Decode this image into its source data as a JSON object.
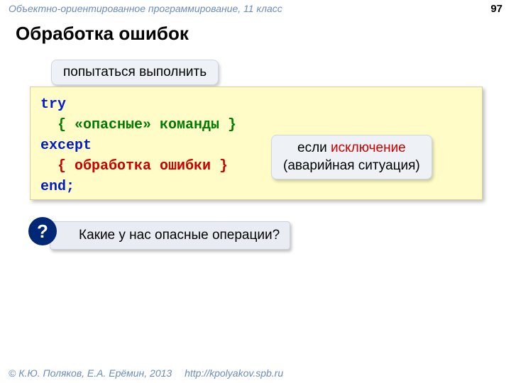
{
  "header": {
    "subject": "Объектно-ориентированное программирование, 11 класс",
    "page": "97"
  },
  "title": "Обработка ошибок",
  "callouts": {
    "top": "попытаться выполнить",
    "right_line1_before": "если ",
    "right_line1_em": "исключение",
    "right_line2": "(аварийная ситуация)"
  },
  "code": {
    "l1": "try",
    "l2": "{ «опасные» команды }",
    "l3": "except",
    "l4": "{ обработка ошибки }",
    "l5": "end;"
  },
  "question": {
    "mark": "?",
    "text": "Какие у нас опасные операции?"
  },
  "footer": {
    "authors": "© К.Ю. Поляков, Е.А. Ерёмин, 2013",
    "url": "http://kpolyakov.spb.ru"
  }
}
